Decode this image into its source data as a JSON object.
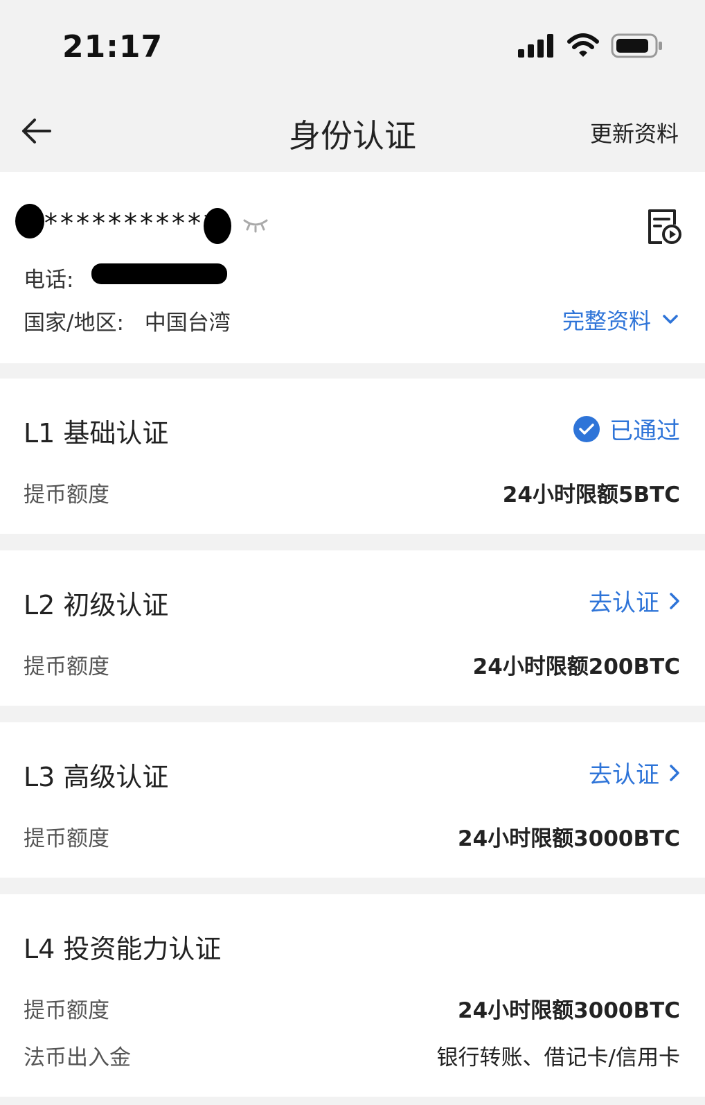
{
  "status_bar": {
    "time": "21:17"
  },
  "nav": {
    "title": "身份认证",
    "action": "更新资料"
  },
  "profile": {
    "masked_name": "***********",
    "phone_label": "电话:",
    "region_label": "国家/地区:",
    "region_value": "中国台湾",
    "complete_link": "完整资料"
  },
  "levels": [
    {
      "title": "L1 基础认证",
      "status": "已通过",
      "label": "提币额度",
      "value": "24小时限额5BTC"
    },
    {
      "title": "L2 初级认证",
      "status": "去认证",
      "label": "提币额度",
      "value": "24小时限额200BTC"
    },
    {
      "title": "L3 高级认证",
      "status": "去认证",
      "label": "提币额度",
      "value": "24小时限额3000BTC"
    },
    {
      "title": "L4 投资能力认证",
      "label": "提币额度",
      "value": "24小时限额3000BTC",
      "label2": "法币出入金",
      "value2": "银行转账、借记卡/信用卡"
    }
  ],
  "colors": {
    "accent": "#2e74d8",
    "background": "#f2f2f2"
  }
}
